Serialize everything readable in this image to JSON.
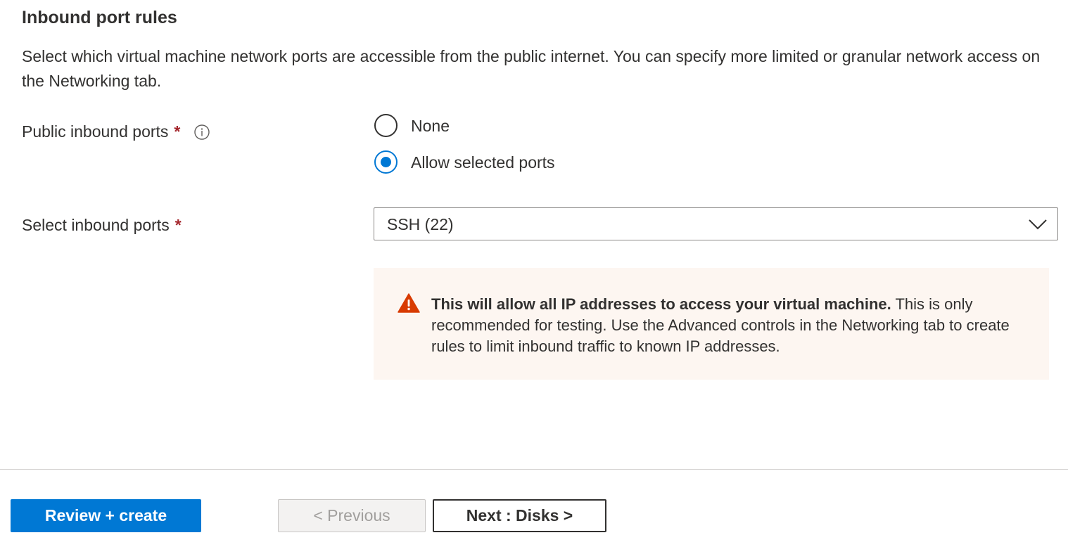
{
  "section": {
    "title": "Inbound port rules",
    "description": "Select which virtual machine network ports are accessible from the public internet. You can specify more limited or granular network access on the Networking tab."
  },
  "public_inbound_ports": {
    "label": "Public inbound ports",
    "required_marker": "*",
    "options": [
      {
        "label": "None",
        "selected": false
      },
      {
        "label": "Allow selected ports",
        "selected": true
      }
    ]
  },
  "select_inbound_ports": {
    "label": "Select inbound ports",
    "required_marker": "*",
    "value": "SSH (22)"
  },
  "warning": {
    "bold_text": "This will allow all IP addresses to access your virtual machine.",
    "text": " This is only recommended for testing.  Use the Advanced controls in the Networking tab to create rules to limit inbound traffic to known IP addresses."
  },
  "footer": {
    "review_create_label": "Review + create",
    "previous_label": "< Previous",
    "next_label": "Next : Disks >"
  },
  "colors": {
    "accent": "#0078d4",
    "required": "#a4262c",
    "warning_icon": "#d83b01",
    "warning_background": "#fdf6f1"
  }
}
